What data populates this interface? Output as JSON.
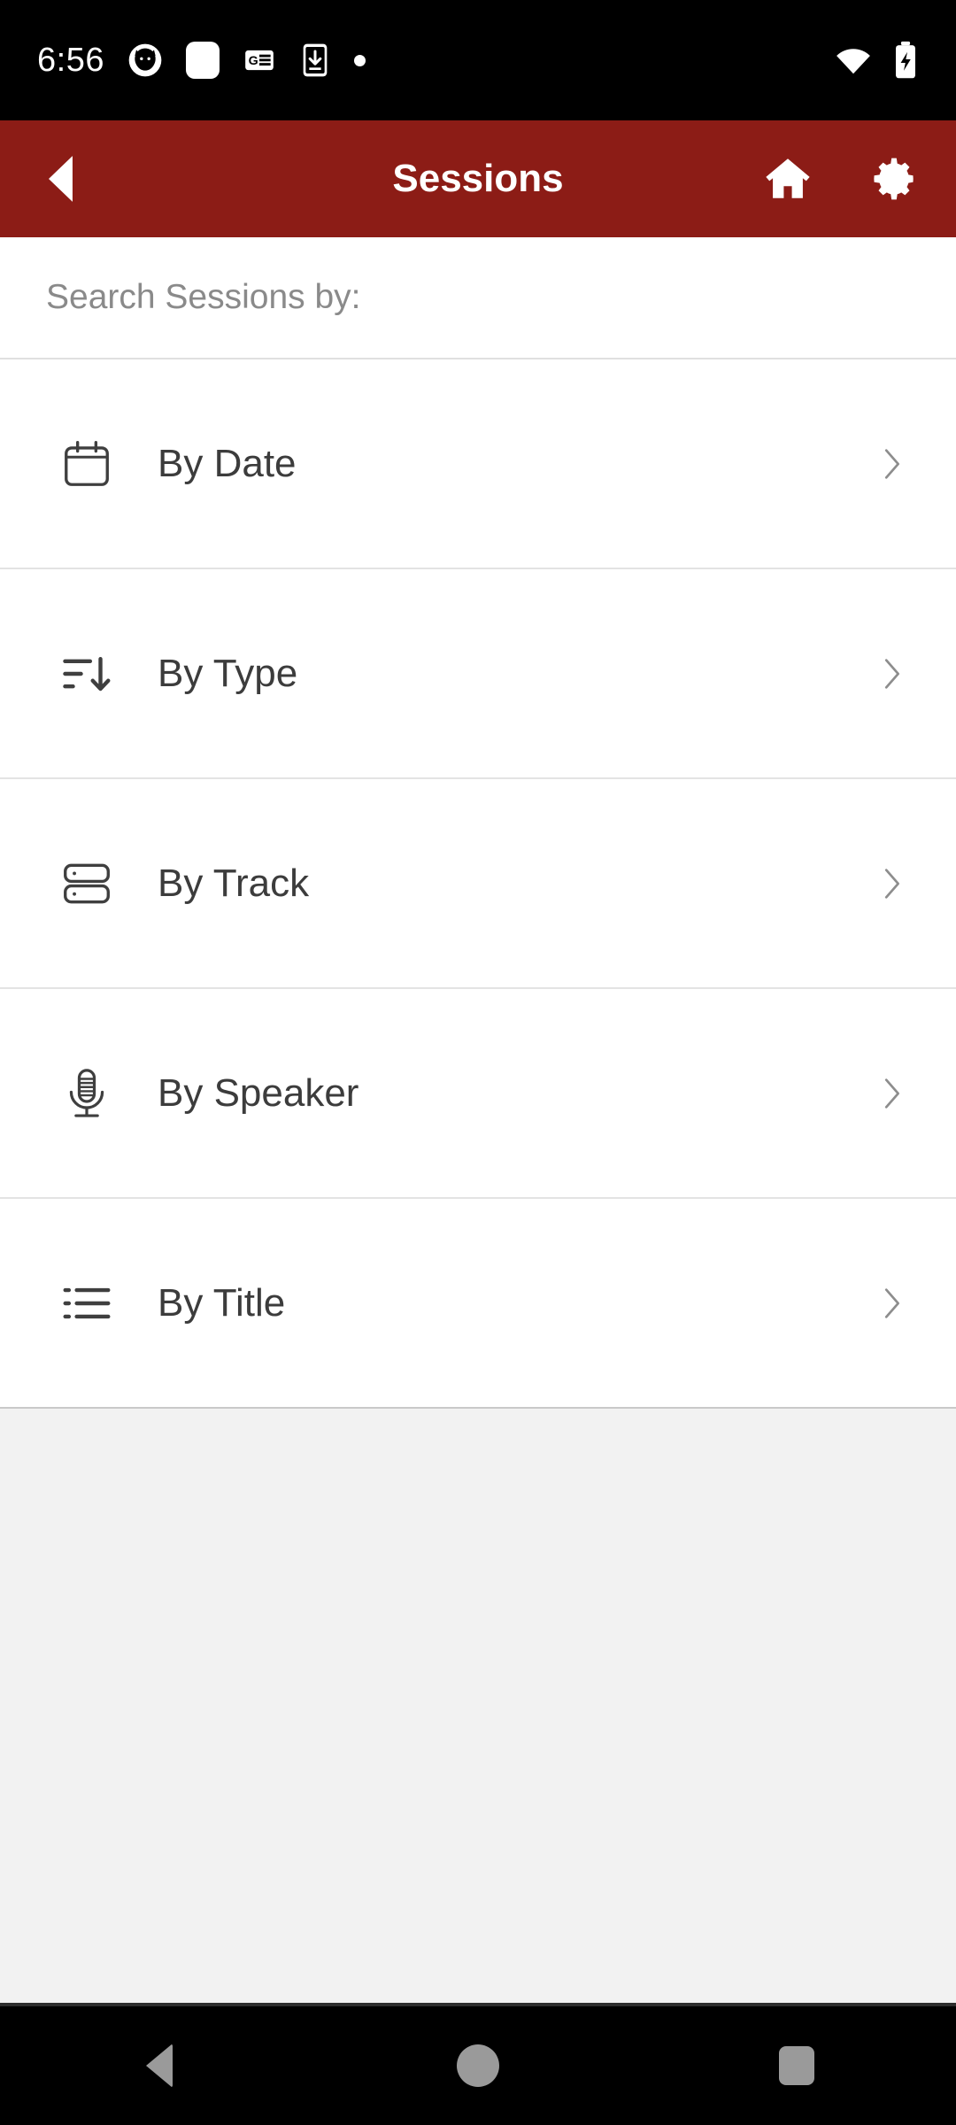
{
  "theme": {
    "appbar_color": "#8c1c16",
    "statusbar_color": "#000000",
    "page_background": "#f2f2f2",
    "card_background": "#ffffff",
    "label_color": "#3c3c3c",
    "muted_color": "#8a8a8a",
    "nav_icon_color": "#9a9a9a"
  },
  "statusbar": {
    "clock": "6:56",
    "left_icons": [
      {
        "name": "cat-app-icon"
      },
      {
        "name": "rounded-square-notification-icon"
      },
      {
        "name": "google-news-icon"
      },
      {
        "name": "app-download-icon"
      },
      {
        "name": "more-notifications-dot-icon"
      }
    ],
    "right_icons": [
      {
        "name": "wifi-icon"
      },
      {
        "name": "battery-charging-icon"
      }
    ]
  },
  "appbar": {
    "title": "Sessions",
    "back_icon": "back-arrow-icon",
    "actions": [
      {
        "name": "home-icon",
        "label": "Home"
      },
      {
        "name": "gear-icon",
        "label": "Settings"
      }
    ]
  },
  "main": {
    "section_header": "Search Sessions by:",
    "rows": [
      {
        "label": "By Date",
        "icon": "calendar-icon",
        "chevron": "chevron-right-icon"
      },
      {
        "label": "By Type",
        "icon": "sort-descending-icon",
        "chevron": "chevron-right-icon"
      },
      {
        "label": "By Track",
        "icon": "server-stack-icon",
        "chevron": "chevron-right-icon"
      },
      {
        "label": "By Speaker",
        "icon": "microphone-icon",
        "chevron": "chevron-right-icon"
      },
      {
        "label": "By Title",
        "icon": "list-icon",
        "chevron": "chevron-right-icon"
      }
    ]
  },
  "navbar": {
    "buttons": [
      {
        "name": "nav-back-button",
        "label": "Back"
      },
      {
        "name": "nav-home-button",
        "label": "Home"
      },
      {
        "name": "nav-recents-button",
        "label": "Recents"
      }
    ]
  }
}
